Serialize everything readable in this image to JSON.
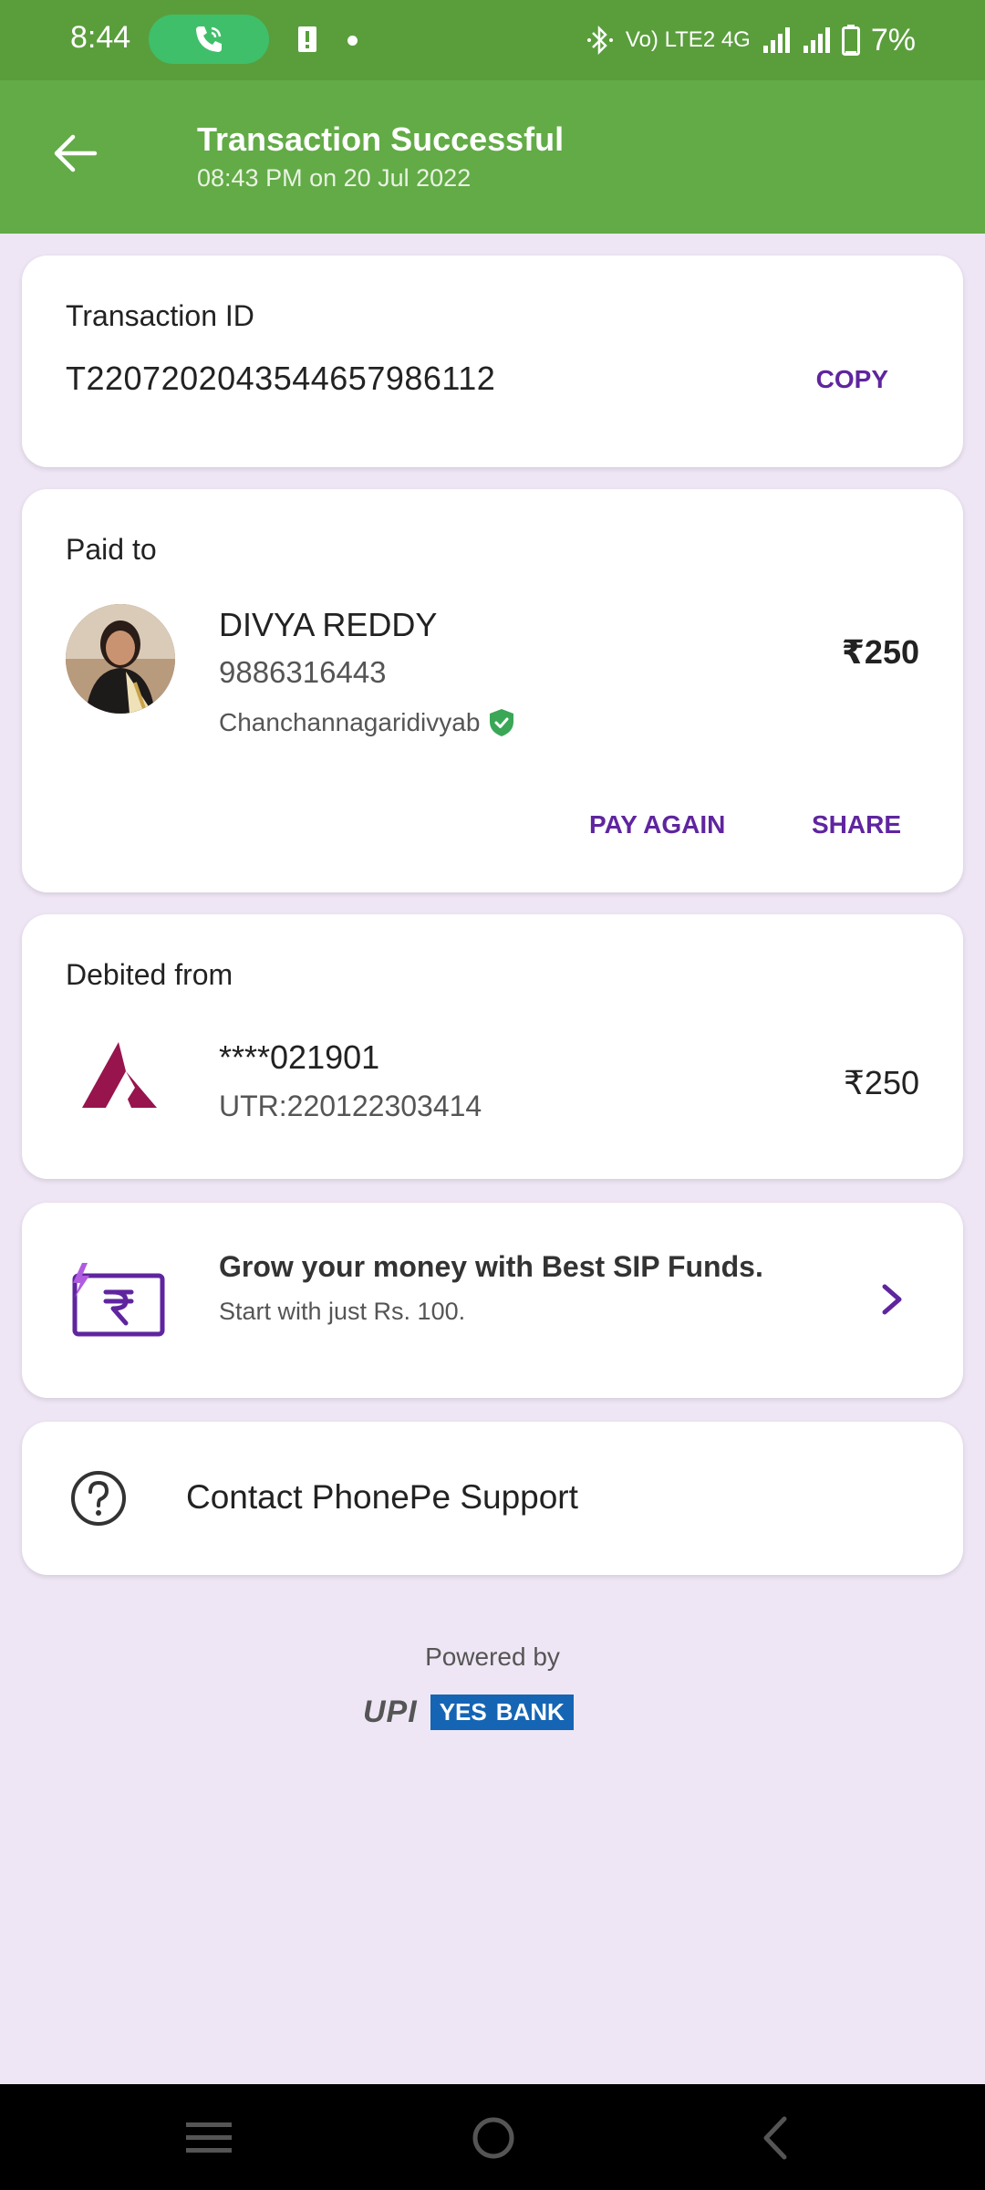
{
  "status_bar": {
    "time": "8:44",
    "network": "Vo) LTE2 4G",
    "battery": "7%"
  },
  "header": {
    "title": "Transaction Successful",
    "subtitle": "08:43 PM on 20 Jul 2022",
    "back_icon": "arrow-left-icon"
  },
  "transaction": {
    "label": "Transaction ID",
    "id": "T2207202043544657986112",
    "copy_label": "COPY"
  },
  "paid_to": {
    "label": "Paid to",
    "name": "DIVYA REDDY",
    "phone": "9886316443",
    "upi_name": "Chanchannagaridivyab",
    "amount": "₹250",
    "pay_again_label": "PAY AGAIN",
    "share_label": "SHARE"
  },
  "debited_from": {
    "label": "Debited from",
    "account": "****021901",
    "utr": "UTR:220122303414",
    "amount": "₹250"
  },
  "promo": {
    "title": "Grow your money with Best SIP Funds.",
    "subtitle": "Start with just Rs. 100."
  },
  "support": {
    "label": "Contact PhonePe Support"
  },
  "footer": {
    "powered_by": "Powered by",
    "upi_text": "UPI",
    "bank_word1": "YES",
    "bank_word2": "BANK"
  },
  "colors": {
    "header_green": "#62ab46",
    "status_green": "#5a9e3c",
    "accent_purple": "#5f259f",
    "background": "#efe6f5",
    "verified_green": "#3aa757"
  }
}
